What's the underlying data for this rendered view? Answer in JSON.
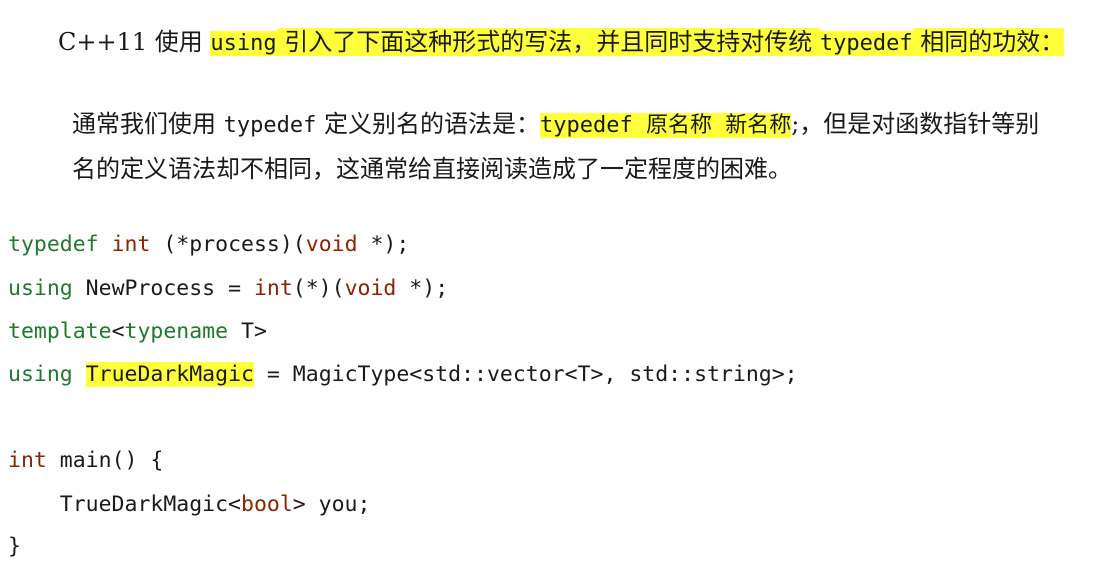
{
  "prose": {
    "line1": {
      "p1": "C++11 使用 ",
      "code1": "using",
      "p2": " 引入了下面这种形式的写法，并且同时支持对传统 ",
      "code2": "typedef",
      "p3": " 相同的功效："
    },
    "line2": {
      "p1": "通常我们使用 ",
      "code1": "typedef",
      "p2": " 定义别名的语法是：",
      "code2": "typedef 原名称 新名称",
      "p3": ";，但是对函数指针等别"
    },
    "line3": {
      "p1": "名的定义语法却不相同，这通常给直接阅读造成了一定程度的困难。"
    }
  },
  "code": {
    "l1": {
      "kw1": "typedef",
      "sp1": " ",
      "kw2": "int",
      "t1": " (*process)(",
      "kw3": "void",
      "t2": " *);"
    },
    "l2": {
      "kw1": "using",
      "t1": " NewProcess = ",
      "kw2": "int",
      "t2": "(*)(",
      "kw3": "void",
      "t3": " *);"
    },
    "l3": {
      "kw1": "template",
      "t1": "<",
      "kw2": "typename",
      "t2": " T>"
    },
    "l4": {
      "kw1": "using",
      "sp1": " ",
      "name": "TrueDarkMagic",
      "t1": " = MagicType<std::vector<T>, std::string>;"
    },
    "l5": {
      "kw1": "int",
      "t1": " main() {"
    },
    "l6": {
      "t1": "    TrueDarkMagic<",
      "kw1": "bool",
      "t2": "> you;"
    },
    "l7": {
      "t1": "}"
    }
  },
  "colors": {
    "highlight": "#ffff3a",
    "keyword_green": "#1f7a2e",
    "keyword_brown": "#8b2500",
    "text": "#1a1a1a",
    "background": "#ffffff"
  }
}
